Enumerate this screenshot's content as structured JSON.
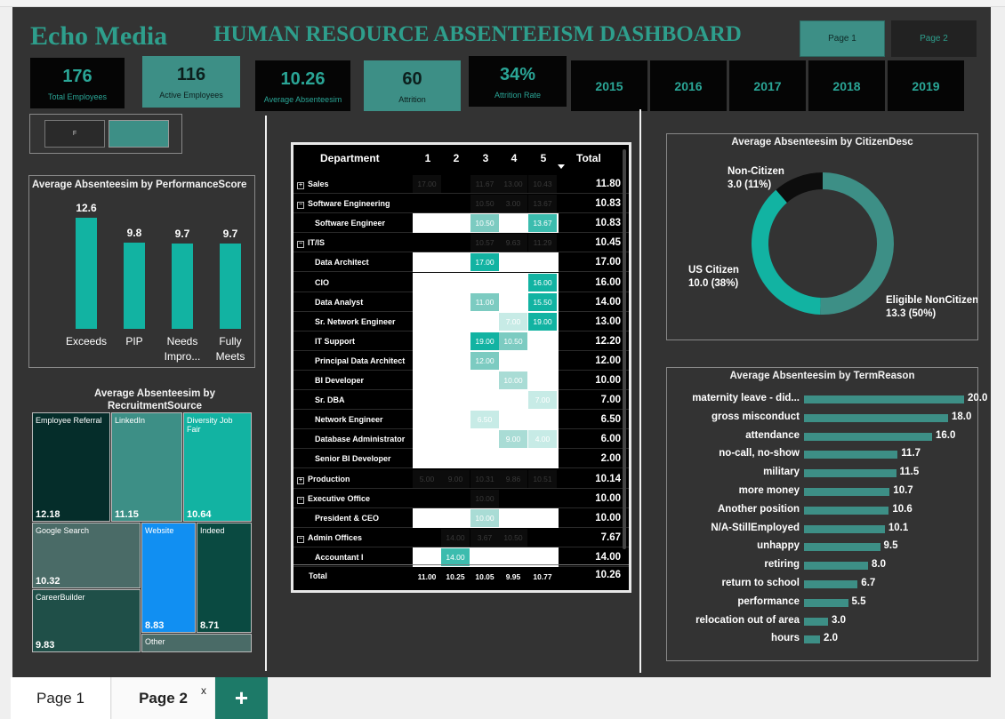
{
  "brand": "Echo Media",
  "dashboard_title": "HUMAN RESOURCE ABSENTEEISM DASHBOARD",
  "page_buttons": [
    "Page 1",
    "Page 2"
  ],
  "kpis": [
    {
      "value": "176",
      "label": "Total Employees"
    },
    {
      "value": "116",
      "label": "Active Employees"
    },
    {
      "value": "10.26",
      "label": "Average Absenteesim"
    },
    {
      "value": "60",
      "label": "Attrition"
    },
    {
      "value": "34%",
      "label": "Attrition Rate"
    }
  ],
  "years": [
    "2015",
    "2016",
    "2017",
    "2018",
    "2019"
  ],
  "sex_slicer": {
    "option_f": "F"
  },
  "colors": {
    "accent": "#12b3a2",
    "teal_dark": "#3d8f86",
    "canvas": "#333333"
  },
  "chart_data": [
    {
      "type": "bar",
      "title": "Average Absenteesim by PerformanceScore",
      "categories": [
        [
          "Exceeds"
        ],
        [
          "PIP"
        ],
        [
          "Needs",
          "Impro..."
        ],
        [
          "Fully",
          "Meets"
        ]
      ],
      "values": [
        12.6,
        9.8,
        9.7,
        9.7
      ],
      "value_labels": [
        "12.6",
        "9.8",
        "9.7",
        "9.7"
      ]
    },
    {
      "type": "heatmap",
      "subtype": "treemap",
      "title": "Average Absenteesim by RecruitmentSource",
      "items": [
        {
          "name": "Employee Referral",
          "value": "12.18"
        },
        {
          "name": "LinkedIn",
          "value": "11.15"
        },
        {
          "name": "Diversity Job Fair",
          "value": "10.64"
        },
        {
          "name": "Google Search",
          "value": "10.32"
        },
        {
          "name": "Website",
          "value": "8.83"
        },
        {
          "name": "Indeed",
          "value": "8.71"
        },
        {
          "name": "CareerBuilder",
          "value": "9.83"
        },
        {
          "name": "Other",
          "value": ""
        }
      ]
    },
    {
      "type": "table",
      "title": "",
      "columns": [
        "Department",
        "1",
        "2",
        "3",
        "4",
        "5",
        "Total"
      ],
      "rows": [
        {
          "name": "Sales",
          "level": 0,
          "toggle": "+",
          "cells": [
            "17.00",
            "",
            "11.67",
            "13.00",
            "10.43"
          ],
          "total": "11.80"
        },
        {
          "name": "Software Engineering",
          "level": 0,
          "toggle": "-",
          "cells": [
            "",
            "",
            "10.50",
            "3.00",
            "13.67"
          ],
          "total": "10.83"
        },
        {
          "name": "Software Engineer",
          "level": 1,
          "toggle": "",
          "cells": [
            "",
            "",
            "10.50",
            "",
            "13.67"
          ],
          "total": "10.83"
        },
        {
          "name": "IT/IS",
          "level": 0,
          "toggle": "-",
          "cells": [
            "",
            "",
            "10.57",
            "9.63",
            "11.29"
          ],
          "total": "10.45"
        },
        {
          "name": "Data Architect",
          "level": 1,
          "toggle": "",
          "cells": [
            "",
            "",
            "17.00",
            "",
            ""
          ],
          "total": "17.00"
        },
        {
          "name": "CIO",
          "level": 1,
          "toggle": "",
          "cells": [
            "",
            "",
            "",
            "",
            "16.00"
          ],
          "total": "16.00"
        },
        {
          "name": "Data Analyst",
          "level": 1,
          "toggle": "",
          "cells": [
            "",
            "",
            "11.00",
            "",
            "15.50"
          ],
          "total": "14.00"
        },
        {
          "name": "Sr. Network Engineer",
          "level": 1,
          "toggle": "",
          "cells": [
            "",
            "",
            "",
            "7.00",
            "19.00"
          ],
          "total": "13.00"
        },
        {
          "name": "IT Support",
          "level": 1,
          "toggle": "",
          "cells": [
            "",
            "",
            "19.00",
            "10.50",
            ""
          ],
          "total": "12.20"
        },
        {
          "name": "Principal Data Architect",
          "level": 1,
          "toggle": "",
          "cells": [
            "",
            "",
            "12.00",
            "",
            ""
          ],
          "total": "12.00"
        },
        {
          "name": "BI Developer",
          "level": 1,
          "toggle": "",
          "cells": [
            "",
            "",
            "",
            "10.00",
            ""
          ],
          "total": "10.00"
        },
        {
          "name": "Sr. DBA",
          "level": 1,
          "toggle": "",
          "cells": [
            "",
            "",
            "",
            "",
            "7.00"
          ],
          "total": "7.00"
        },
        {
          "name": "Network Engineer",
          "level": 1,
          "toggle": "",
          "cells": [
            "",
            "",
            "6.50",
            "",
            ""
          ],
          "total": "6.50"
        },
        {
          "name": "Database Administrator",
          "level": 1,
          "toggle": "",
          "cells": [
            "",
            "",
            "",
            "9.00",
            "4.00"
          ],
          "total": "6.00"
        },
        {
          "name": "Senior BI Developer",
          "level": 1,
          "toggle": "",
          "cells": [
            "",
            "",
            "",
            "",
            ""
          ],
          "total": "2.00"
        },
        {
          "name": "Production",
          "level": 0,
          "toggle": "+",
          "cells": [
            "5.00",
            "9.00",
            "10.31",
            "9.86",
            "10.51"
          ],
          "total": "10.14"
        },
        {
          "name": "Executive Office",
          "level": 0,
          "toggle": "-",
          "cells": [
            "",
            "",
            "10.00",
            "",
            ""
          ],
          "total": "10.00"
        },
        {
          "name": "President & CEO",
          "level": 1,
          "toggle": "",
          "cells": [
            "",
            "",
            "10.00",
            "",
            ""
          ],
          "total": "10.00"
        },
        {
          "name": "Admin Offices",
          "level": 0,
          "toggle": "-",
          "cells": [
            "",
            "14.00",
            "3.67",
            "10.50",
            ""
          ],
          "total": "7.67"
        },
        {
          "name": "Accountant I",
          "level": 1,
          "toggle": "",
          "cells": [
            "",
            "14.00",
            "",
            "",
            ""
          ],
          "total": "14.00"
        }
      ],
      "footer": {
        "name": "Total",
        "cells": [
          "11.00",
          "10.25",
          "10.05",
          "9.95",
          "10.77"
        ],
        "total": "10.26"
      }
    },
    {
      "type": "pie",
      "subtype": "donut",
      "title": "Average Absenteesim by CitizenDesc",
      "slices": [
        {
          "name": "Eligible NonCitizen",
          "value": 13.3,
          "label": "13.3 (50%)",
          "percent": 50,
          "color": "#3d8f86"
        },
        {
          "name": "US Citizen",
          "value": 10.0,
          "label": "10.0 (38%)",
          "percent": 38,
          "color": "#12b3a2"
        },
        {
          "name": "Non-Citizen",
          "value": 3.0,
          "label": "3.0 (11%)",
          "percent": 11,
          "color": "#0d0d0d"
        }
      ]
    },
    {
      "type": "bar",
      "orientation": "horizontal",
      "title": "Average Absenteesim by TermReason",
      "categories": [
        "maternity leave - did...",
        "gross misconduct",
        "attendance",
        "no-call, no-show",
        "military",
        "more money",
        "Another position",
        "N/A-StillEmployed",
        "unhappy",
        "retiring",
        "return to school",
        "performance",
        "relocation out of area",
        "hours"
      ],
      "values": [
        20.0,
        18.0,
        16.0,
        11.7,
        11.5,
        10.7,
        10.6,
        10.1,
        9.5,
        8.0,
        6.7,
        5.5,
        3.0,
        2.0
      ],
      "value_labels": [
        "20.0",
        "18.0",
        "16.0",
        "11.7",
        "11.5",
        "10.7",
        "10.6",
        "10.1",
        "9.5",
        "8.0",
        "6.7",
        "5.5",
        "3.0",
        "2.0"
      ]
    }
  ],
  "bottom_tabs": {
    "tab1": "Page 1",
    "tab2": "Page 2",
    "close": "x",
    "add": "+"
  }
}
